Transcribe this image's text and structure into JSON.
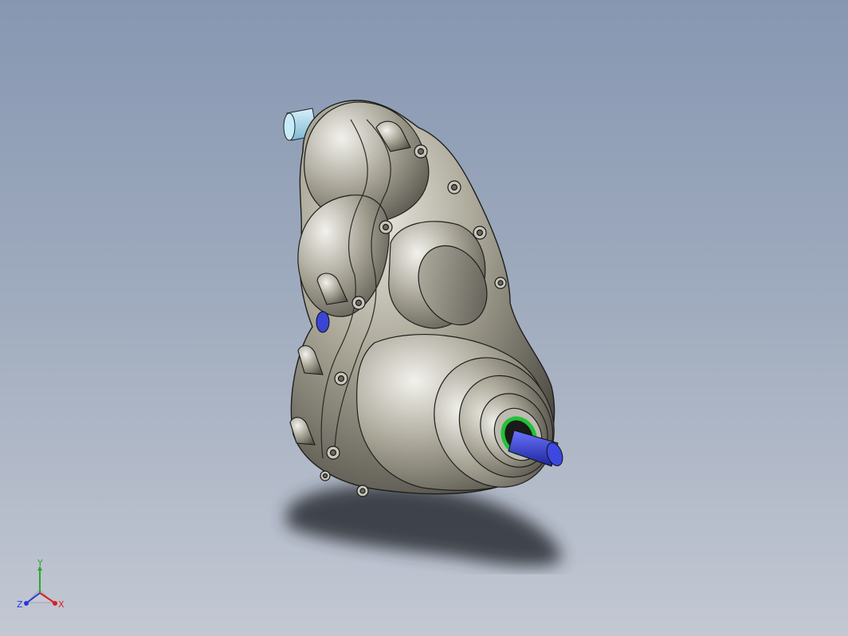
{
  "viewport": {
    "background_top": "#8797b2",
    "background_bottom": "#c3c8d3"
  },
  "model": {
    "housing_color": "#9c998a",
    "input_shaft_color": "#a9d9ee",
    "output_shaft_color": "#3a45d6",
    "seal_color": "#22c23a",
    "icon": "gearbox-assembly"
  },
  "triad": {
    "x_label": "X",
    "y_label": "Y",
    "z_label": "Z",
    "x_color": "#d62020",
    "y_color": "#2aa82a",
    "z_color": "#2a3ad6"
  }
}
